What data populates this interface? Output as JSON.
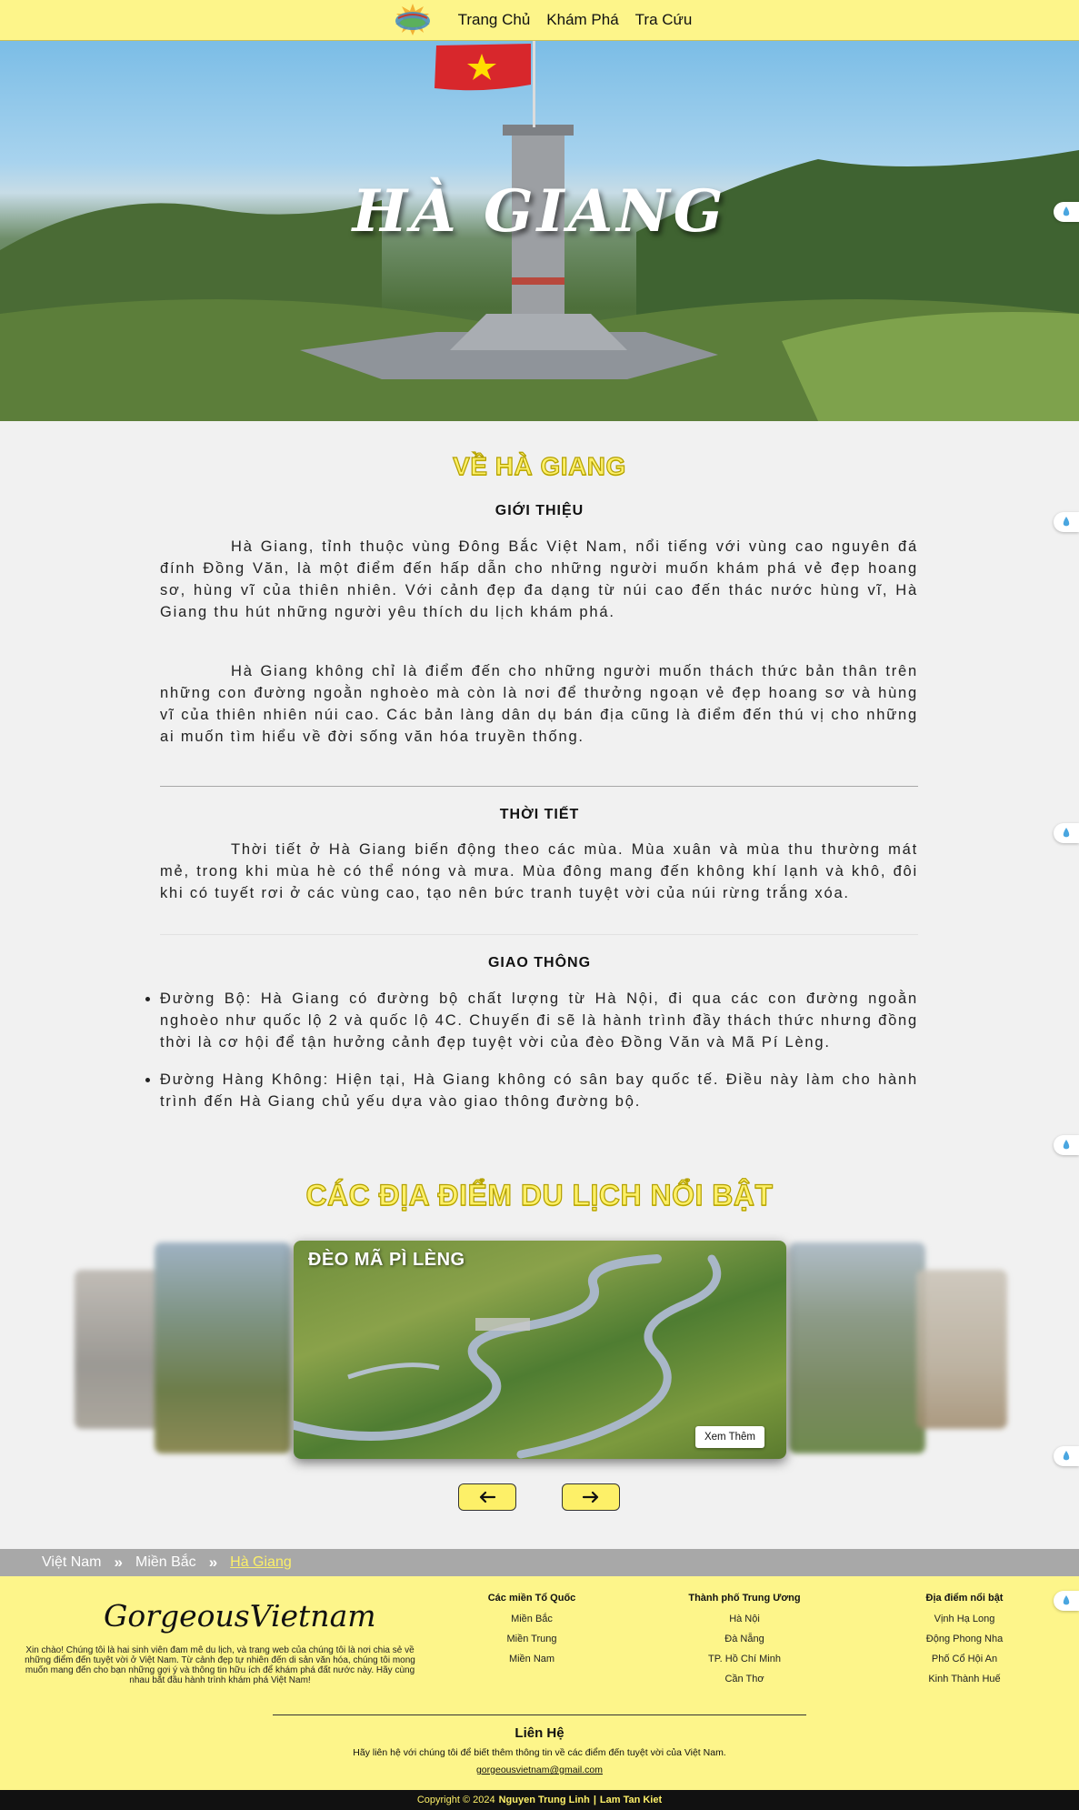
{
  "nav": {
    "items": [
      {
        "label": "Trang Chủ"
      },
      {
        "label": "Khám Phá"
      },
      {
        "label": "Tra Cứu"
      }
    ]
  },
  "hero": {
    "title": "HÀ GIANG"
  },
  "about": {
    "heading": "VỀ HÀ GIANG",
    "intro_title": "GIỚI THIỆU",
    "intro_p1": "Hà Giang, tỉnh thuộc vùng Đông Bắc Việt Nam, nổi tiếng với vùng cao nguyên đá đính Đồng Văn, là một điểm đến hấp dẫn cho những người muốn khám phá vẻ đẹp hoang sơ, hùng vĩ của thiên nhiên. Với cảnh đẹp đa dạng từ núi cao đến thác nước hùng vĩ, Hà Giang thu hút những người yêu thích du lịch khám phá.",
    "intro_p2": "Hà Giang không chỉ là điểm đến cho những người muốn thách thức bản thân trên những con đường ngoằn nghoèo mà còn là nơi để thưởng ngoạn vẻ đẹp hoang sơ và hùng vĩ của thiên nhiên núi cao. Các bản làng dân dụ bán địa cũng là điểm đến thú vị cho những ai muốn tìm hiểu về đời sống văn hóa truyền thống.",
    "weather_title": "THỜI TIẾT",
    "weather_p": "Thời tiết ở Hà Giang biến động theo các mùa. Mùa xuân và mùa thu thường mát mẻ, trong khi mùa hè có thể nóng và mưa. Mùa đông mang đến không khí lạnh và khô, đôi khi có tuyết rơi ở các vùng cao, tạo nên bức tranh tuyệt vời của núi rừng trắng xóa.",
    "transport_title": "GIAO THÔNG",
    "transport_items": [
      {
        "text": "Đường Bộ: Hà Giang có đường bộ chất lượng từ Hà Nội, đi qua các con đường ngoằn nghoèo như quốc lộ 2 và quốc lộ 4C. Chuyến đi sẽ là hành trình đầy thách thức nhưng đồng thời là cơ hội để tận hưởng cảnh đẹp tuyệt vời của đèo Đồng Văn và Mã Pí Lèng."
      },
      {
        "text": "Đường Hàng Không: Hiện tại, Hà Giang không có sân bay quốc tế. Điều này làm cho hành trình đến Hà Giang chủ yếu dựa vào giao thông đường bộ."
      }
    ]
  },
  "places": {
    "heading": "CÁC ĐỊA ĐIỂM DU LỊCH NỔI BẬT",
    "active_card": {
      "title": "ĐÈO MÃ PÌ LÈNG",
      "button": "Xem Thêm"
    }
  },
  "breadcrumb": {
    "items": [
      {
        "label": "Việt Nam"
      },
      {
        "label": "Miền Bắc"
      },
      {
        "label": "Hà Giang"
      }
    ]
  },
  "footer": {
    "brand": "GorgeousVietnam",
    "description": "Xin chào! Chúng tôi là hai sinh viên đam mê du lịch, và trang web của chúng tôi là nơi chia sẻ về những điểm đến tuyệt vời ở Việt Nam. Từ cảnh đẹp tự nhiên đến di sản văn hóa, chúng tôi mong muốn mang đến cho bạn những gợi ý và thông tin hữu ích để khám phá đất nước này. Hãy cùng nhau bắt đầu hành trình khám phá Việt Nam!",
    "columns": [
      {
        "title": "Các miền Tổ Quốc",
        "items": [
          "Miền Bắc",
          "Miền Trung",
          "Miền Nam"
        ]
      },
      {
        "title": "Thành phố Trung Ương",
        "items": [
          "Hà Nội",
          "Đà Nẵng",
          "TP. Hồ Chí Minh",
          "Cần Thơ"
        ]
      },
      {
        "title": "Địa điểm nổi bật",
        "items": [
          "Vịnh Hạ Long",
          "Động Phong Nha",
          "Phố Cổ Hội An",
          "Kinh Thành Huế"
        ]
      }
    ],
    "contact_title": "Liên Hệ",
    "contact_text": "Hãy liên hệ với chúng tôi để biết thêm thông tin về các điểm đến tuyệt vời của Việt Nam.",
    "contact_email": "gorgeousvietnam@gmail.com",
    "copyright_prefix": "Copyright © 2024",
    "author1": "Nguyen Trung Linh",
    "separator": "|",
    "author2": "Lam Tan Kiet"
  },
  "colors": {
    "accent_yellow": "#fdf58a",
    "heading_yellow": "#fdf068",
    "breadcrumb_gray": "#a8a8a8",
    "footer_dark": "#111111"
  }
}
